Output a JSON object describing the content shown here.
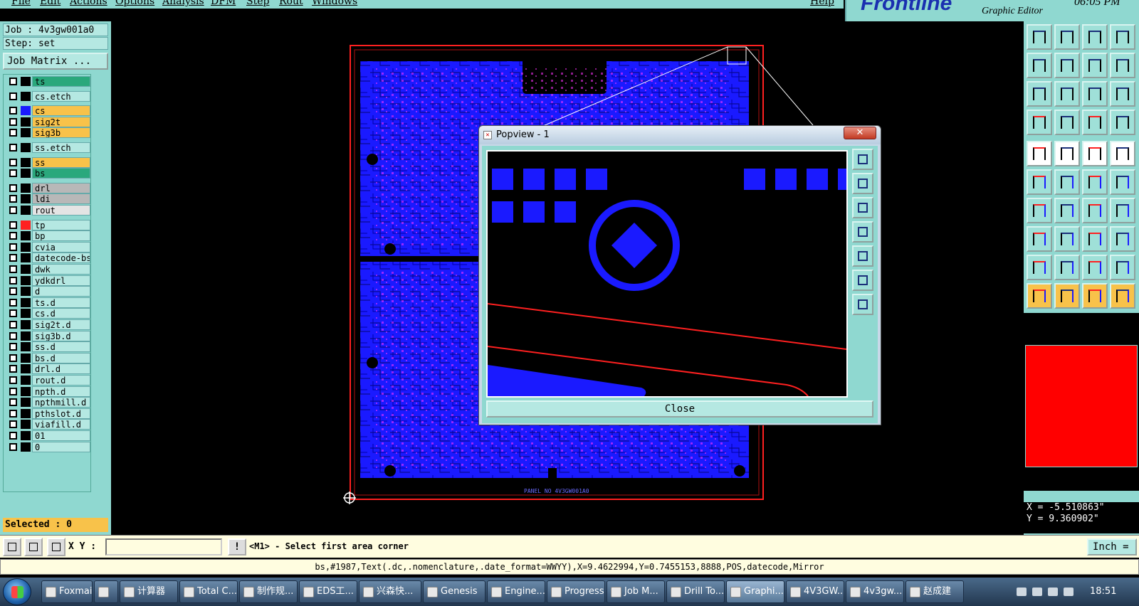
{
  "menu": {
    "items": [
      "File",
      "Edit",
      "Actions",
      "Options",
      "Analysis",
      "DFM",
      "Step",
      "Rout",
      "Windows"
    ],
    "help": "Help"
  },
  "logo": {
    "brand": "Frontline",
    "subtitle": "Graphic Editor",
    "clock": "06:05 PM"
  },
  "job": {
    "job_label": "Job : 4v3gw001a0",
    "step_label": "Step: set",
    "matrix_button": "Job Matrix ..."
  },
  "layers": [
    {
      "name": "ts",
      "bg": "#2aa87c",
      "swatch": "#000000"
    },
    {
      "name": "cs.etch",
      "bg": "#b5e8e2",
      "swatch": "#000000"
    },
    {
      "name": "cs",
      "bg": "#f8c24a",
      "swatch": "#1a1aff"
    },
    {
      "name": "sig2t",
      "bg": "#f8c24a",
      "swatch": "#000000"
    },
    {
      "name": "sig3b",
      "bg": "#f8c24a",
      "swatch": "#000000"
    },
    {
      "name": "ss.etch",
      "bg": "#b5e8e2",
      "swatch": "#000000"
    },
    {
      "name": "ss",
      "bg": "#f8c24a",
      "swatch": "#000000"
    },
    {
      "name": "bs",
      "bg": "#2aa87c",
      "swatch": "#000000"
    },
    {
      "name": "drl",
      "bg": "#b8b8b8",
      "swatch": "#000000"
    },
    {
      "name": "ldi",
      "bg": "#b8b8b8",
      "swatch": "#000000"
    },
    {
      "name": "rout",
      "bg": "#e4e4e4",
      "swatch": "#000000"
    },
    {
      "name": "tp",
      "bg": "#b5e8e2",
      "swatch": "#ff2020"
    },
    {
      "name": "bp",
      "bg": "#b5e8e2",
      "swatch": "#000000"
    },
    {
      "name": "cvia",
      "bg": "#b5e8e2",
      "swatch": "#000000"
    },
    {
      "name": "datecode-bs",
      "bg": "#b5e8e2",
      "swatch": "#000000"
    },
    {
      "name": "dwk",
      "bg": "#b5e8e2",
      "swatch": "#000000"
    },
    {
      "name": "ydkdrl",
      "bg": "#b5e8e2",
      "swatch": "#000000"
    },
    {
      "name": "d",
      "bg": "#b5e8e2",
      "swatch": "#000000"
    },
    {
      "name": "ts.d",
      "bg": "#b5e8e2",
      "swatch": "#000000"
    },
    {
      "name": "cs.d",
      "bg": "#b5e8e2",
      "swatch": "#000000"
    },
    {
      "name": "sig2t.d",
      "bg": "#b5e8e2",
      "swatch": "#000000"
    },
    {
      "name": "sig3b.d",
      "bg": "#b5e8e2",
      "swatch": "#000000"
    },
    {
      "name": "ss.d",
      "bg": "#b5e8e2",
      "swatch": "#000000"
    },
    {
      "name": "bs.d",
      "bg": "#b5e8e2",
      "swatch": "#000000"
    },
    {
      "name": "drl.d",
      "bg": "#b5e8e2",
      "swatch": "#000000"
    },
    {
      "name": "rout.d",
      "bg": "#b5e8e2",
      "swatch": "#000000"
    },
    {
      "name": "npth.d",
      "bg": "#b5e8e2",
      "swatch": "#000000"
    },
    {
      "name": "npthmill.d",
      "bg": "#b5e8e2",
      "swatch": "#000000"
    },
    {
      "name": "pthslot.d",
      "bg": "#b5e8e2",
      "swatch": "#000000"
    },
    {
      "name": "viafill.d",
      "bg": "#b5e8e2",
      "swatch": "#000000"
    },
    {
      "name": "01",
      "bg": "#b5e8e2",
      "swatch": "#000000"
    },
    {
      "name": "0",
      "bg": "#b5e8e2",
      "swatch": "#000000"
    }
  ],
  "selected_label": "Selected : 0",
  "popview": {
    "title": "Popview - 1",
    "close_x": "✕",
    "close_button": "Close"
  },
  "board": {
    "panel_text": "PANEL NO 4V3GW001A0"
  },
  "coords": {
    "x": "X = -5.510863\"",
    "y": "Y = 9.360902\""
  },
  "command": {
    "xy_label": "X Y :",
    "xy_value": "",
    "bang": "!",
    "prompt": "<M1> - Select first area corner",
    "unit": "Inch ="
  },
  "status_line": "bs,#1987,Text(.dc,.nomenclature,.date_format=WWYY),X=9.4622994,Y=0.7455153,8888,POS,datecode,Mirror",
  "taskbar": {
    "tasks": [
      "Foxmail",
      "",
      "计算器",
      "Total C...",
      "制作规...",
      "EDS工...",
      "兴森快...",
      "Genesis",
      "Engine...",
      "Progress",
      "Job M...",
      "Drill To...",
      "Graphi...",
      "4V3GW...",
      "4v3gw...",
      "赵成建"
    ],
    "clock": "18:51"
  },
  "colors": {
    "panel": "#8fd8d0",
    "copper": "#1a1aff",
    "outline": "#ff2020",
    "pad": "#ff33ff"
  }
}
